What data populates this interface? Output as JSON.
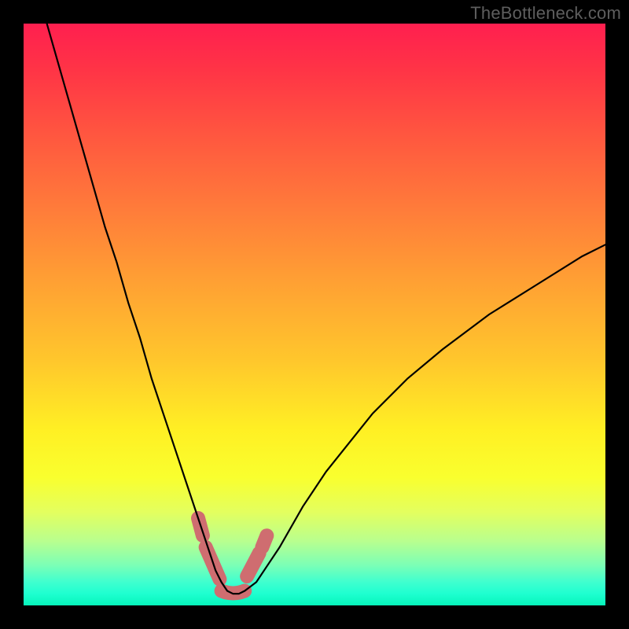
{
  "watermark": "TheBottleneck.com",
  "colors": {
    "frame_bg": "#000000",
    "marker": "#cf6d70",
    "curve": "#000000",
    "gradient_top": "#ff1f4f",
    "gradient_bottom": "#06f5bb"
  },
  "chart_data": {
    "type": "line",
    "title": "",
    "xlabel": "",
    "ylabel": "",
    "xlim": [
      0,
      100
    ],
    "ylim": [
      0,
      100
    ],
    "series": [
      {
        "name": "bottleneck-curve",
        "x": [
          4,
          6,
          8,
          10,
          12,
          14,
          16,
          18,
          20,
          22,
          24,
          26,
          28,
          30,
          31,
          32,
          33,
          34,
          35,
          36,
          37,
          38,
          40,
          42,
          44,
          48,
          52,
          56,
          60,
          66,
          72,
          80,
          88,
          96,
          100
        ],
        "y": [
          100,
          93,
          86,
          79,
          72,
          65,
          59,
          52,
          46,
          39,
          33,
          27,
          21,
          15,
          12,
          9,
          6,
          4,
          2.5,
          2,
          2,
          2.5,
          4,
          7,
          10,
          17,
          23,
          28,
          33,
          39,
          44,
          50,
          55,
          60,
          62
        ]
      }
    ],
    "markers": [
      {
        "name": "left-segment-1",
        "x_range": [
          30.0,
          30.8
        ],
        "y_range": [
          15.0,
          12.0
        ]
      },
      {
        "name": "left-segment-2",
        "x_range": [
          31.3,
          33.7
        ],
        "y_range": [
          10.0,
          4.5
        ]
      },
      {
        "name": "bottom-u",
        "x_range": [
          34.0,
          38.0
        ],
        "y_range": [
          2.5,
          2.5
        ]
      },
      {
        "name": "right-segment-1",
        "x_range": [
          38.4,
          40.5
        ],
        "y_range": [
          5.0,
          9.0
        ]
      },
      {
        "name": "right-segment-2",
        "x_range": [
          41.0,
          41.8
        ],
        "y_range": [
          10.0,
          12.0
        ]
      }
    ],
    "notes": "Background is a vertical red-to-green gradient; curve is a V shape with minimum near x≈36. Pink rounded segments annotate the bottom region of the curve near the minimum. No axis ticks or labels are visible."
  }
}
